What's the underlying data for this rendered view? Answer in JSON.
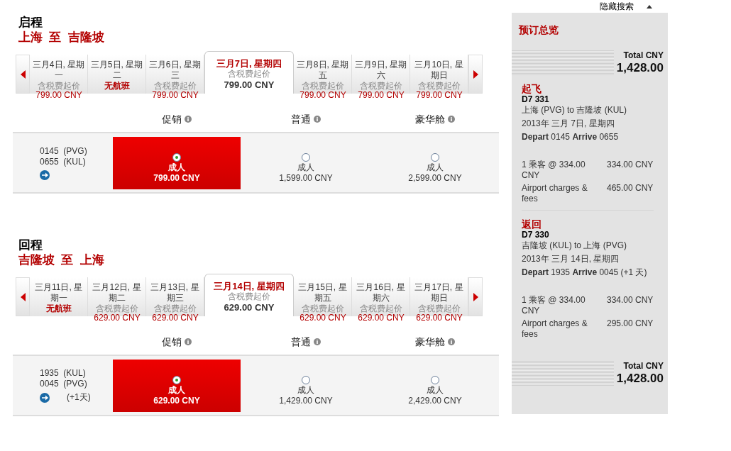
{
  "journeys": [
    {
      "heading": "启程",
      "route": "上海  至  吉隆坡",
      "dates": [
        {
          "label": "三月4日, 星期一",
          "sub": "含税费起价",
          "price": "799.00 CNY",
          "no_flight": false,
          "selected": false
        },
        {
          "label": "三月5日, 星期二",
          "no_flight": true,
          "status": "无航班",
          "selected": false
        },
        {
          "label": "三月6日, 星期三",
          "sub": "含税费起价",
          "price": "799.00 CNY",
          "no_flight": false,
          "selected": false
        },
        {
          "label": "三月7日, 星期四",
          "sub": "含税费起价",
          "price": "799.00 CNY",
          "no_flight": false,
          "selected": true
        },
        {
          "label": "三月8日, 星期五",
          "sub": "含税费起价",
          "price": "799.00 CNY",
          "no_flight": false,
          "selected": false
        },
        {
          "label": "三月9日, 星期六",
          "sub": "含税费起价",
          "price": "799.00 CNY",
          "no_flight": false,
          "selected": false
        },
        {
          "label": "三月10日, 星期日",
          "sub": "含税费起价",
          "price": "799.00 CNY",
          "no_flight": false,
          "selected": false
        }
      ],
      "fare_classes": [
        "促销",
        "普通",
        "豪华舱"
      ],
      "flight": {
        "depart": "0145  (PVG)",
        "arrive": "0655  (KUL)",
        "fares": [
          {
            "label": "成人",
            "price": "799.00 CNY",
            "selected": true
          },
          {
            "label": "成人",
            "price": "1,599.00 CNY",
            "selected": false
          },
          {
            "label": "成人",
            "price": "2,599.00 CNY",
            "selected": false
          }
        ]
      }
    },
    {
      "heading": "回程",
      "route": "吉隆坡  至  上海",
      "dates": [
        {
          "label": "三月11日, 星期一",
          "no_flight": true,
          "status": "无航班",
          "selected": false
        },
        {
          "label": "三月12日, 星期二",
          "sub": "含税费起价",
          "price": "629.00 CNY",
          "no_flight": false,
          "selected": false
        },
        {
          "label": "三月13日, 星期三",
          "sub": "含税费起价",
          "price": "629.00 CNY",
          "no_flight": false,
          "selected": false
        },
        {
          "label": "三月14日, 星期四",
          "sub": "含税费起价",
          "price": "629.00 CNY",
          "no_flight": false,
          "selected": true
        },
        {
          "label": "三月15日, 星期五",
          "sub": "含税费起价",
          "price": "629.00 CNY",
          "no_flight": false,
          "selected": false
        },
        {
          "label": "三月16日, 星期六",
          "sub": "含税费起价",
          "price": "629.00 CNY",
          "no_flight": false,
          "selected": false
        },
        {
          "label": "三月17日, 星期日",
          "sub": "含税费起价",
          "price": "629.00 CNY",
          "no_flight": false,
          "selected": false
        }
      ],
      "fare_classes": [
        "促销",
        "普通",
        "豪华舱"
      ],
      "flight": {
        "depart": "1935  (KUL)",
        "arrive": "0045  (PVG)",
        "day_note": "(+1天)",
        "fares": [
          {
            "label": "成人",
            "price": "629.00 CNY",
            "selected": true
          },
          {
            "label": "成人",
            "price": "1,429.00 CNY",
            "selected": false
          },
          {
            "label": "成人",
            "price": "2,429.00 CNY",
            "selected": false
          }
        ]
      }
    }
  ],
  "summary": {
    "hide_search": "隐藏搜索",
    "title": "预订总览",
    "total_label": "Total CNY",
    "total": "1,428.00",
    "segments": [
      {
        "title": "起飞",
        "flight_no": "D7 331",
        "route": "上海 (PVG) to 吉隆坡 (KUL)",
        "date": "2013年 三月 7日, 星期四",
        "times": "**Depart** 0145 **Arrive** 0655",
        "charges": [
          {
            "label": "1 乘客 @ 334.00 CNY",
            "amount": "334.00 CNY"
          },
          {
            "label": "Airport charges & fees",
            "amount": "465.00 CNY"
          }
        ]
      },
      {
        "title": "返回",
        "flight_no": "D7 330",
        "route": "吉隆坡 (KUL) to 上海 (PVG)",
        "date": "2013年 三月 14日, 星期四",
        "times": "**Depart** 1935 **Arrive** 0045 (+1 天)",
        "charges": [
          {
            "label": "1 乘客 @ 334.00 CNY",
            "amount": "334.00 CNY"
          },
          {
            "label": "Airport charges & fees",
            "amount": "295.00 CNY"
          }
        ]
      }
    ],
    "bottom_total_label": "Total CNY",
    "bottom_total": "1,428.00"
  }
}
